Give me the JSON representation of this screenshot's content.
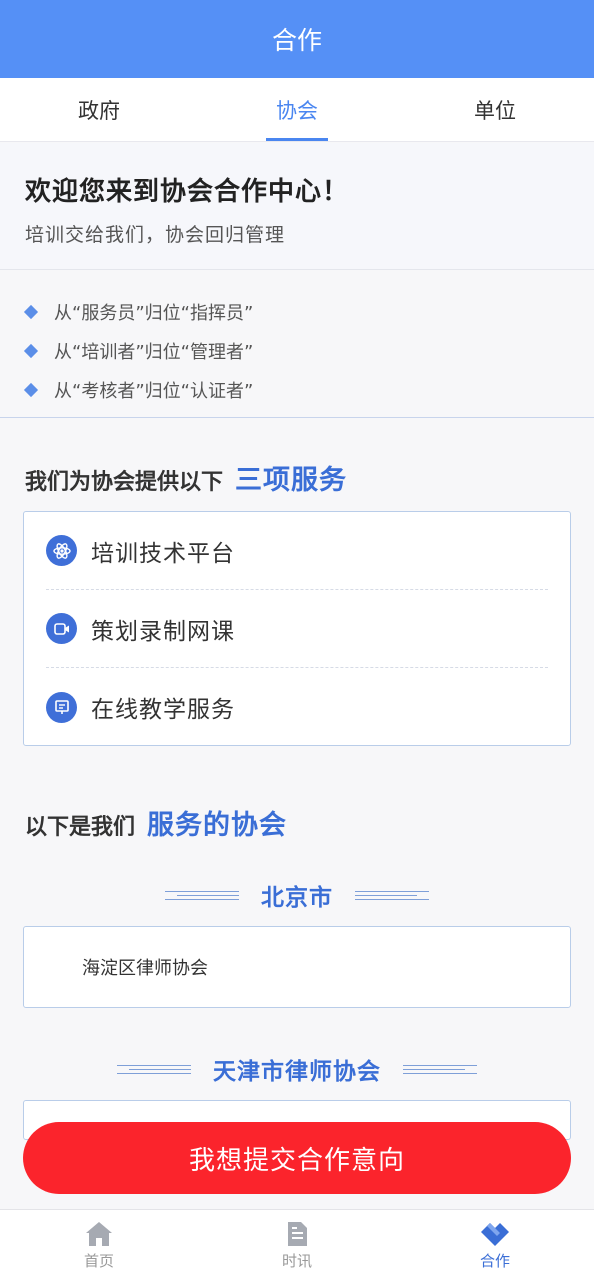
{
  "header": {
    "title": "合作"
  },
  "tabs": [
    {
      "label": "政府",
      "active": false
    },
    {
      "label": "协会",
      "active": true
    },
    {
      "label": "单位",
      "active": false
    }
  ],
  "welcome": {
    "title": "欢迎您来到协会合作中心！",
    "subtitle": "培训交给我们，协会回归管理"
  },
  "points": [
    "从“服务员”归位“指挥员”",
    "从“培训者”归位“管理者”",
    "从“考核者”归位“认证者”"
  ],
  "services_section": {
    "title_dark": "我们为协会提供以下",
    "title_blue": "三项服务",
    "items": [
      {
        "label": "培训技术平台",
        "icon": "atom-icon"
      },
      {
        "label": "策划录制网课",
        "icon": "video-icon"
      },
      {
        "label": "在线教学服务",
        "icon": "presentation-icon"
      }
    ]
  },
  "associations_section": {
    "title_dark": "以下是我们",
    "title_blue": "服务的协会",
    "groups": [
      {
        "name": "北京市",
        "items": [
          "海淀区律师协会"
        ]
      },
      {
        "name": "天津市律师协会",
        "items": []
      }
    ]
  },
  "submit": {
    "label": "我想提交合作意向"
  },
  "bottom_nav": [
    {
      "label": "首页",
      "icon": "home-icon",
      "active": false
    },
    {
      "label": "时讯",
      "icon": "document-icon",
      "active": false
    },
    {
      "label": "合作",
      "icon": "cooperation-icon",
      "active": true
    }
  ],
  "colors": {
    "header": "#5590f6",
    "accent": "#3a6ed6",
    "submit": "#fb242c"
  }
}
